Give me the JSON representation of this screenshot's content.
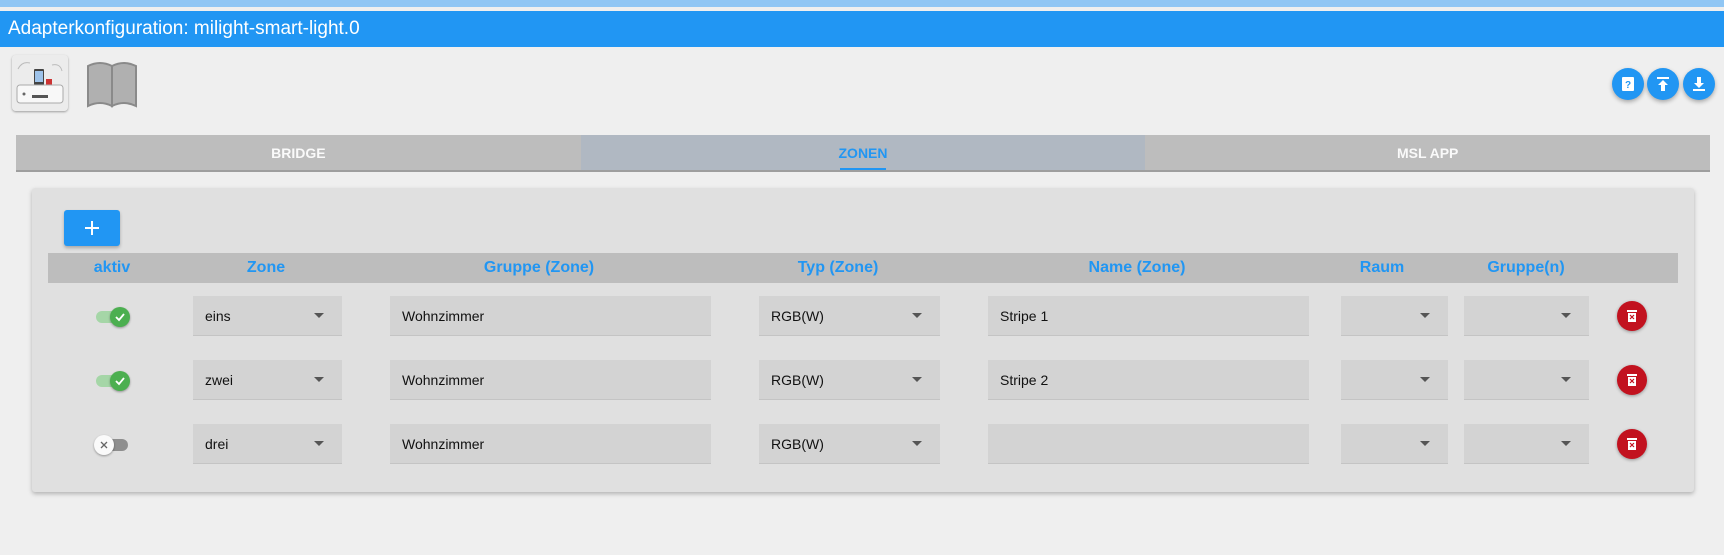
{
  "app": {
    "title": "Adapterkonfiguration: milight-smart-light.0",
    "accent_color": "#2196f3",
    "delete_color": "#c2121f"
  },
  "header_icons": {
    "logo": "milight-bridge-logo",
    "docs": "book-icon",
    "buttons": [
      "help-icon",
      "upload-icon",
      "download-icon"
    ]
  },
  "tabs": [
    {
      "label": "BRIDGE",
      "active": false
    },
    {
      "label": "ZONEN",
      "active": true
    },
    {
      "label": "MSL APP",
      "active": false
    }
  ],
  "add_button": {
    "label": "+"
  },
  "table": {
    "headers": [
      "aktiv",
      "Zone",
      "Gruppe (Zone)",
      "Typ (Zone)",
      "Name (Zone)",
      "Raum",
      "Gruppe(n)"
    ],
    "rows": [
      {
        "aktiv": true,
        "zone": "eins",
        "gruppe": "Wohnzimmer",
        "typ": "RGB(W)",
        "name": "Stripe 1",
        "raum": "",
        "gruppen": ""
      },
      {
        "aktiv": true,
        "zone": "zwei",
        "gruppe": "Wohnzimmer",
        "typ": "RGB(W)",
        "name": "Stripe 2",
        "raum": "",
        "gruppen": ""
      },
      {
        "aktiv": false,
        "zone": "drei",
        "gruppe": "Wohnzimmer",
        "typ": "RGB(W)",
        "name": "",
        "raum": "",
        "gruppen": ""
      }
    ]
  }
}
